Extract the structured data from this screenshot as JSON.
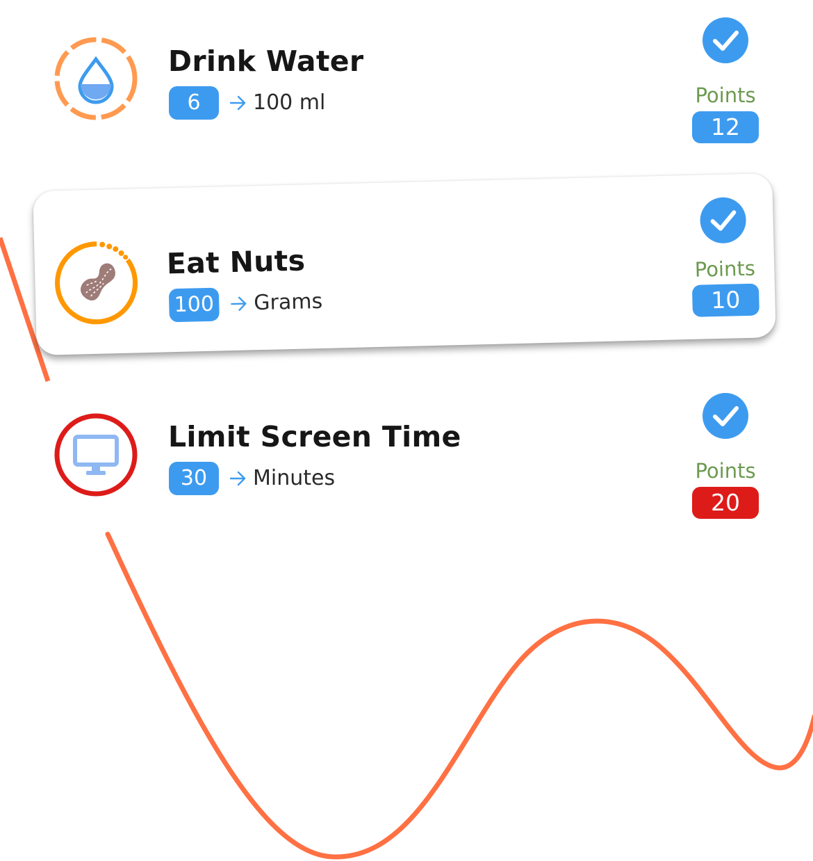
{
  "colors": {
    "accent_blue": "#3d9bef",
    "points_green": "#6c9a50",
    "alert_red": "#dd1c1a",
    "ring_orange": "#ff8c42",
    "curve_orange": "#ff7043"
  },
  "tasks": [
    {
      "title": "Drink Water",
      "quantity": "6",
      "unit": "100 ml",
      "points_label": "Points",
      "points": "12",
      "completed": true,
      "icon": "water-drop-icon"
    },
    {
      "title": "Eat Nuts",
      "quantity": "100",
      "unit": "Grams",
      "points_label": "Points",
      "points": "10",
      "completed": true,
      "icon": "peanut-icon"
    },
    {
      "title": "Limit Screen Time",
      "quantity": "30",
      "unit": "Minutes",
      "points_label": "Points",
      "points": "20",
      "completed": true,
      "icon": "monitor-icon"
    }
  ]
}
